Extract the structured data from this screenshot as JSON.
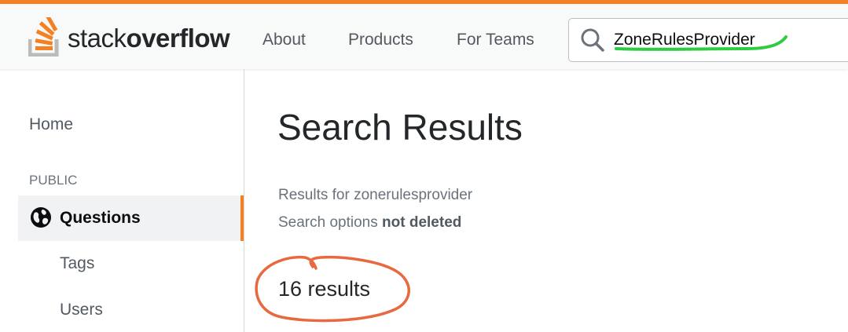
{
  "header": {
    "logo": {
      "text_light": "stack",
      "text_bold": "overflow"
    },
    "nav": [
      "About",
      "Products",
      "For Teams"
    ],
    "search": {
      "value": "ZoneRulesProvider",
      "icon": "search-icon"
    }
  },
  "sidebar": {
    "home": "Home",
    "section_label": "PUBLIC",
    "questions": "Questions",
    "tags": "Tags",
    "users": "Users"
  },
  "main": {
    "title": "Search Results",
    "results_for_prefix": "Results for ",
    "results_for_query": "zonerulesprovider",
    "search_options_prefix": "Search options ",
    "search_options_value": "not deleted",
    "result_count": "16 results"
  },
  "colors": {
    "accent": "#f48024",
    "annotation_green": "#2ecc40",
    "annotation_orange": "#e8693f"
  }
}
